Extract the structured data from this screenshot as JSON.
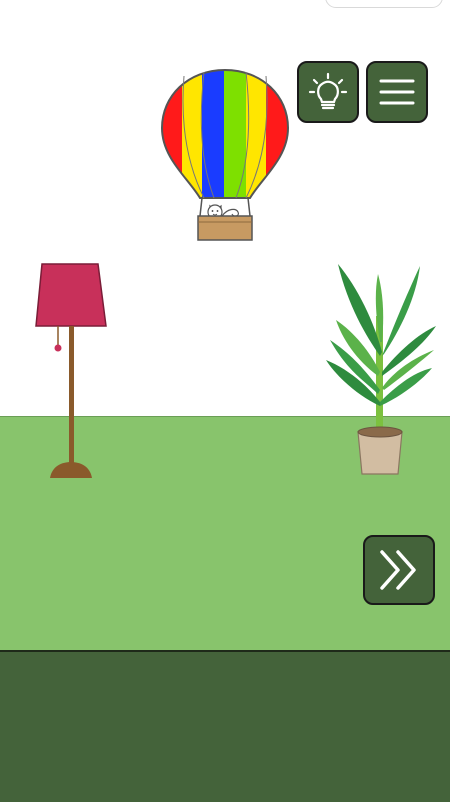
{
  "game": {
    "scene": "room",
    "colors": {
      "wall": "#ffffff",
      "floor": "#88c46c",
      "bottom_bar": "#44633a",
      "button": "#44633a",
      "lamp_shade": "#c8305a",
      "lamp_pole": "#8a5a2b",
      "pot": "#d2bda2",
      "leaf": "#2e8b3e"
    }
  },
  "hud": {
    "hint_icon": "lightbulb-icon",
    "menu_icon": "hamburger-menu-icon",
    "next_icon": "double-chevron-right-icon"
  },
  "objects": {
    "balloon": {
      "icon": "hot-air-balloon-with-cat",
      "stripes": [
        "#ff1a1a",
        "#ffe600",
        "#1a3cff",
        "#7ee000",
        "#ffe600",
        "#ff1a1a"
      ]
    },
    "lamp": {
      "icon": "floor-lamp"
    },
    "plant": {
      "icon": "potted-plant"
    }
  }
}
